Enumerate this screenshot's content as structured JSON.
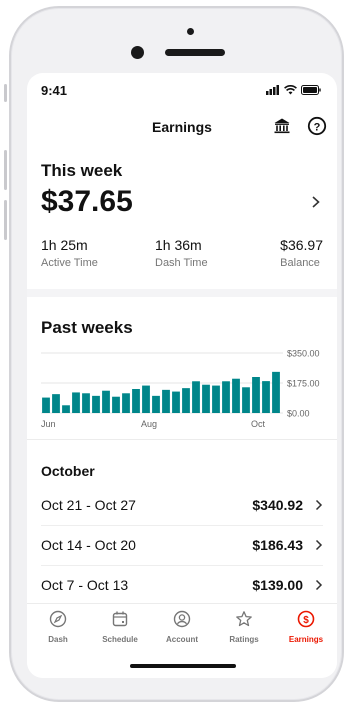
{
  "status": {
    "time": "9:41"
  },
  "nav": {
    "title": "Earnings",
    "bank_icon": "bank-icon",
    "help_icon": "help-icon"
  },
  "this_week": {
    "title": "This week",
    "amount": "$37.65",
    "stats": [
      {
        "value": "1h 25m",
        "label": "Active Time"
      },
      {
        "value": "1h 36m",
        "label": "Dash Time"
      },
      {
        "value": "$36.97",
        "label": "Balance"
      }
    ]
  },
  "past_weeks": {
    "title": "Past weeks"
  },
  "chart_data": {
    "type": "bar",
    "title": "Past weeks",
    "x_ticks": [
      "Jun",
      "Aug",
      "Oct"
    ],
    "y_ticks": [
      "$350.00",
      "$175.00",
      "$0.00"
    ],
    "ylim": [
      0,
      350
    ],
    "grid": true,
    "color": "#00868a",
    "values": [
      90,
      110,
      45,
      120,
      115,
      100,
      130,
      95,
      115,
      140,
      160,
      100,
      135,
      125,
      145,
      185,
      165,
      160,
      185,
      200,
      150,
      210,
      186,
      240
    ]
  },
  "october": {
    "title": "October",
    "rows": [
      {
        "range": "Oct 21 - Oct 27",
        "amount": "$340.92"
      },
      {
        "range": "Oct 14 - Oct 20",
        "amount": "$186.43"
      },
      {
        "range": "Oct 7 - Oct 13",
        "amount": "$139.00"
      }
    ]
  },
  "tabs": [
    {
      "label": "Dash",
      "icon": "compass-icon"
    },
    {
      "label": "Schedule",
      "icon": "calendar-icon"
    },
    {
      "label": "Account",
      "icon": "account-icon"
    },
    {
      "label": "Ratings",
      "icon": "star-icon"
    },
    {
      "label": "Earnings",
      "icon": "earnings-icon",
      "active": true
    }
  ],
  "colors": {
    "accent": "#eb1700",
    "bar": "#00868a"
  }
}
